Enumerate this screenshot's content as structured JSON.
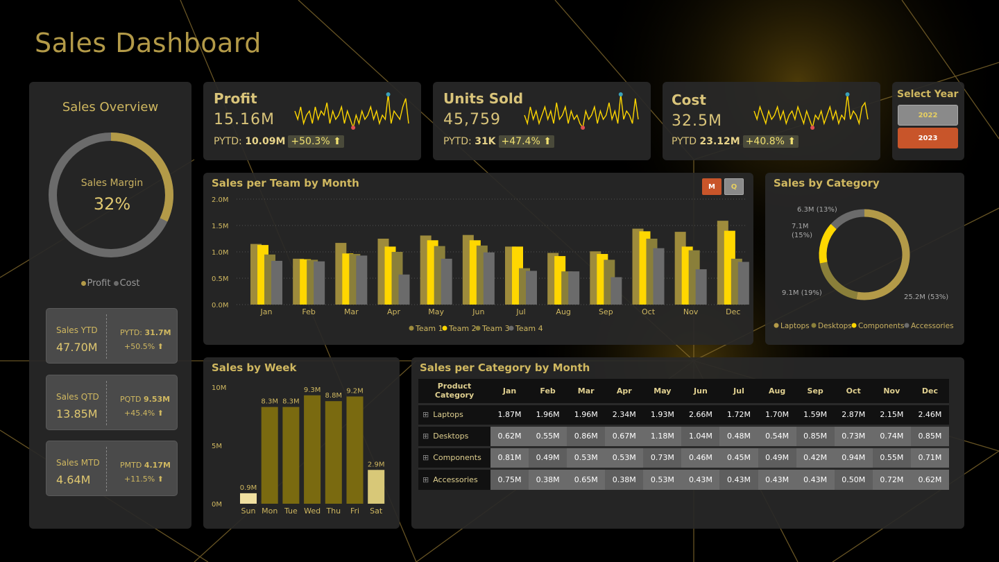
{
  "title": "Sales Dashboard",
  "colors": {
    "gold": "#b39a48",
    "yellow": "#ffd700",
    "olive": "#9e8b3c",
    "grey": "#6b6b6b",
    "orange": "#c8552a",
    "teal": "#3aa0b8",
    "red": "#e05050"
  },
  "overview": {
    "title": "Sales Overview",
    "donut_label": "Sales Margin",
    "donut_value": "32%",
    "margin_fraction": 0.32,
    "legend": [
      {
        "name": "Profit",
        "color": "#b39a48"
      },
      {
        "name": "Cost",
        "color": "#6b6b6b"
      }
    ],
    "cards": [
      {
        "label": "Sales YTD",
        "value": "47.70M",
        "prev_label": "PYTD:",
        "prev_value": "31.7M",
        "change": "+50.5%"
      },
      {
        "label": "Sales QTD",
        "value": "13.85M",
        "prev_label": "PQTD",
        "prev_value": "9.53M",
        "change": "+45.4%"
      },
      {
        "label": "Sales MTD",
        "value": "4.64M",
        "prev_label": "PMTD",
        "prev_value": "4.17M",
        "change": "+11.5%"
      }
    ]
  },
  "kpis": [
    {
      "title": "Profit",
      "value": "15.16M",
      "prev_label": "PYTD:",
      "prev_value": "10.09M",
      "change": "+50.3%",
      "spark": [
        5,
        3,
        6,
        2,
        4,
        5,
        2,
        6,
        3,
        5,
        4,
        7,
        2,
        5,
        3,
        4,
        6,
        2,
        5,
        3,
        1,
        4,
        2,
        5,
        3,
        4,
        6,
        3,
        5,
        2,
        4,
        3,
        9,
        2,
        5,
        4,
        3,
        6,
        8,
        2
      ]
    },
    {
      "title": "Units Sold",
      "value": "45,759",
      "prev_label": "PYTD:",
      "prev_value": "31K",
      "change": "+47.4%",
      "spark": [
        4,
        2,
        6,
        3,
        5,
        2,
        4,
        6,
        3,
        5,
        2,
        7,
        3,
        4,
        6,
        2,
        5,
        3,
        4,
        2,
        1,
        5,
        3,
        4,
        6,
        2,
        5,
        3,
        4,
        7,
        3,
        5,
        2,
        9,
        3,
        5,
        4,
        2,
        8,
        3
      ]
    },
    {
      "title": "Cost",
      "value": "32.5M",
      "prev_label": "PYTD",
      "prev_value": "23.12M",
      "change": "+40.8%",
      "spark": [
        5,
        3,
        6,
        4,
        2,
        5,
        3,
        4,
        6,
        3,
        5,
        2,
        4,
        5,
        3,
        6,
        4,
        2,
        5,
        3,
        1,
        4,
        3,
        5,
        2,
        4,
        6,
        3,
        5,
        2,
        4,
        3,
        9,
        3,
        5,
        4,
        2,
        6,
        7,
        3
      ]
    }
  ],
  "select_year": {
    "title": "Select Year",
    "options": [
      "2022",
      "2023"
    ],
    "selected": "2023"
  },
  "team_chart": {
    "title": "Sales per Team by Month",
    "toggle": [
      "M",
      "Q"
    ],
    "chart_data": {
      "type": "bar",
      "categories": [
        "Jan",
        "Feb",
        "Mar",
        "Apr",
        "May",
        "Jun",
        "Jul",
        "Aug",
        "Sep",
        "Oct",
        "Nov",
        "Dec"
      ],
      "yticks": [
        "0.0M",
        "0.5M",
        "1.0M",
        "1.5M",
        "2.0M"
      ],
      "ylim": [
        0,
        2.0
      ],
      "series": [
        {
          "name": "Team 1",
          "color": "#9e8b3c",
          "values": [
            1.15,
            0.87,
            1.17,
            1.25,
            1.31,
            1.32,
            1.1,
            0.98,
            1.01,
            1.44,
            1.38,
            1.59
          ]
        },
        {
          "name": "Team 2",
          "color": "#ffd700",
          "values": [
            1.13,
            0.86,
            0.97,
            1.1,
            1.22,
            1.22,
            1.1,
            0.92,
            0.96,
            1.39,
            1.1,
            1.4
          ]
        },
        {
          "name": "Team 3",
          "color": "#8a7f3a",
          "values": [
            0.95,
            0.85,
            0.96,
            1.0,
            1.11,
            1.12,
            0.69,
            0.63,
            0.85,
            1.25,
            1.03,
            0.87
          ]
        },
        {
          "name": "Team 4",
          "color": "#6b6b6b",
          "values": [
            0.83,
            0.82,
            0.93,
            0.57,
            0.87,
            0.99,
            0.64,
            0.63,
            0.52,
            1.07,
            0.67,
            0.81
          ]
        }
      ]
    }
  },
  "category_chart": {
    "title": "Sales by Category",
    "chart_data": {
      "type": "pie",
      "categories": [
        "Laptops",
        "Desktops",
        "Components",
        "Accessories"
      ],
      "values": [
        25.2,
        9.1,
        7.1,
        6.3
      ],
      "labels": [
        "25.2M (53%)",
        "9.1M (19%)",
        "7.1M\n(15%)",
        "6.3M (13%)"
      ],
      "colors": [
        "#b39a48",
        "#8a7f3a",
        "#ffd700",
        "#6b6b6b"
      ]
    }
  },
  "week_chart": {
    "title": "Sales by Week",
    "chart_data": {
      "type": "bar",
      "categories": [
        "Sun",
        "Mon",
        "Tue",
        "Wed",
        "Thu",
        "Fri",
        "Sat"
      ],
      "values": [
        0.9,
        8.3,
        8.3,
        9.3,
        8.8,
        9.2,
        2.9
      ],
      "labels": [
        "0.9M",
        "8.3M",
        "8.3M",
        "9.3M",
        "8.8M",
        "9.2M",
        "2.9M"
      ],
      "yticks": [
        "0M",
        "5M",
        "10M"
      ],
      "ylim": [
        0,
        10
      ]
    }
  },
  "matrix": {
    "title": "Sales per Category by Month",
    "header": [
      "Product Category",
      "Jan",
      "Feb",
      "Mar",
      "Apr",
      "May",
      "Jun",
      "Jul",
      "Aug",
      "Sep",
      "Oct",
      "Nov",
      "Dec"
    ],
    "rows": [
      {
        "name": "Laptops",
        "values": [
          "1.87M",
          "1.96M",
          "1.96M",
          "2.34M",
          "1.93M",
          "2.66M",
          "1.72M",
          "1.70M",
          "1.59M",
          "2.87M",
          "2.15M",
          "2.46M"
        ]
      },
      {
        "name": "Desktops",
        "values": [
          "0.62M",
          "0.55M",
          "0.86M",
          "0.67M",
          "1.18M",
          "1.04M",
          "0.48M",
          "0.54M",
          "0.85M",
          "0.73M",
          "0.74M",
          "0.85M"
        ]
      },
      {
        "name": "Components",
        "values": [
          "0.81M",
          "0.49M",
          "0.53M",
          "0.53M",
          "0.73M",
          "0.46M",
          "0.45M",
          "0.49M",
          "0.42M",
          "0.94M",
          "0.55M",
          "0.71M"
        ]
      },
      {
        "name": "Accessories",
        "values": [
          "0.75M",
          "0.38M",
          "0.65M",
          "0.38M",
          "0.53M",
          "0.43M",
          "0.43M",
          "0.43M",
          "0.43M",
          "0.50M",
          "0.72M",
          "0.62M"
        ]
      }
    ]
  }
}
